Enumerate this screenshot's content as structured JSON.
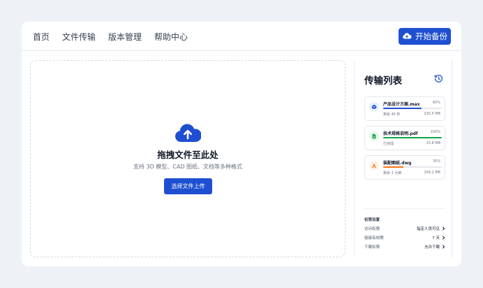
{
  "nav": {
    "items": [
      "首页",
      "文件传输",
      "版本管理",
      "帮助中心"
    ],
    "action_label": "开始备份"
  },
  "dropzone": {
    "title": "拖拽文件至此处",
    "subtitle": "支持 3D 模型、CAD 图纸、文档等多种格式",
    "button_label": "选择文件上传"
  },
  "transfers": {
    "title": "传输列表",
    "files": [
      {
        "name": "产品设计方案.max",
        "percent": "65%",
        "progress": 0.65,
        "status": "剩余 45 秒",
        "size": "230.5 MB",
        "color": "#1f4fd1",
        "icon_bg": "#e8efff",
        "icon": "cube-icon"
      },
      {
        "name": "技术规格说明.pdf",
        "percent": "100%",
        "progress": 1.0,
        "status": "已完成",
        "size": "15.8 MB",
        "color": "#16a34a",
        "icon_bg": "#e7f7ec",
        "icon": "document-icon"
      },
      {
        "name": "装配图纸.dwg",
        "percent": "35%",
        "progress": 0.35,
        "status": "剩余 2 分钟",
        "size": "156.2 MB",
        "color": "#f97316",
        "icon_bg": "#fff1e6",
        "icon": "drafting-icon"
      }
    ]
  },
  "permissions": {
    "title": "权限设置",
    "rows": [
      {
        "label": "访问权限",
        "value": "指定人员可见"
      },
      {
        "label": "链接有效期",
        "value": "7 天"
      },
      {
        "label": "下载权限",
        "value": "允许下载"
      }
    ]
  },
  "colors": {
    "accent": "#1f4fd1",
    "success": "#16a34a",
    "warning": "#f97316"
  }
}
